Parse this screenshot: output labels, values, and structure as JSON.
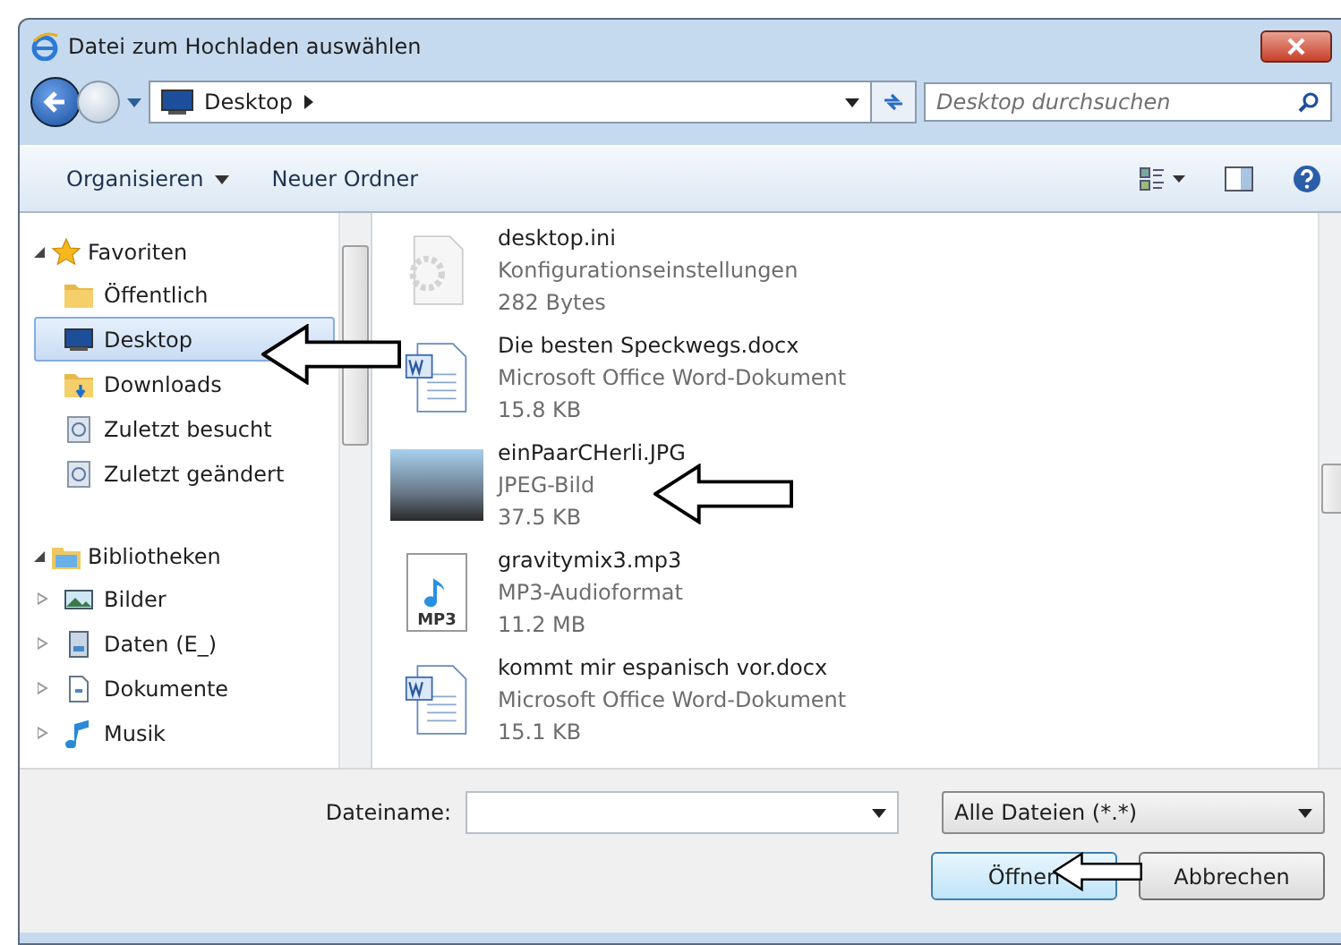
{
  "window": {
    "title": "Datei zum Hochladen auswählen"
  },
  "nav": {
    "address": "Desktop",
    "search_placeholder": "Desktop durchsuchen"
  },
  "toolbar": [
    {
      "label": "Organisieren",
      "dropdown": true
    },
    {
      "label": "Neuer Ordner",
      "dropdown": false
    }
  ],
  "sidebar": [
    {
      "label": "Favoriten",
      "expanded": true,
      "children": [
        {
          "label": "Öffentlich",
          "selected": false
        },
        {
          "label": "Desktop",
          "selected": true
        },
        {
          "label": "Downloads",
          "selected": false
        },
        {
          "label": "Zuletzt besucht",
          "selected": false
        },
        {
          "label": "Zuletzt geändert",
          "selected": false
        }
      ]
    },
    {
      "label": "Bibliotheken",
      "expanded": true,
      "children": [
        {
          "label": "Bilder",
          "selected": false,
          "expanded": false
        },
        {
          "label": "Daten (E_)",
          "selected": false,
          "expanded": false
        },
        {
          "label": "Dokumente",
          "selected": false,
          "expanded": false
        },
        {
          "label": "Musik",
          "selected": false,
          "expanded": false
        }
      ]
    }
  ],
  "files": [
    {
      "kind": "config",
      "name": "desktop.ini",
      "type": "Konfigurationseinstellungen",
      "size": "282 Bytes"
    },
    {
      "kind": "word",
      "name": "Die besten Speckwegs.docx",
      "type": "Microsoft Office Word-Dokument",
      "size": "15.8 KB"
    },
    {
      "kind": "photo",
      "name": "einPaarCHerli.JPG",
      "type": "JPEG-Bild",
      "size": "37.5 KB"
    },
    {
      "kind": "audio",
      "name": "gravitymix3.mp3",
      "type": "MP3-Audioformat",
      "size": "11.2 MB",
      "icon_text": "MP3"
    },
    {
      "kind": "word",
      "name": "kommt mir espanisch vor.docx",
      "type": "Microsoft Office Word-Dokument",
      "size": "15.1 KB"
    }
  ],
  "bottom": {
    "filename_label": "Dateiname:",
    "filter": "Alle Dateien (*.*)",
    "buttons": [
      {
        "label": "Öffnen",
        "default": true
      },
      {
        "label": "Abbrechen",
        "default": false
      }
    ]
  }
}
